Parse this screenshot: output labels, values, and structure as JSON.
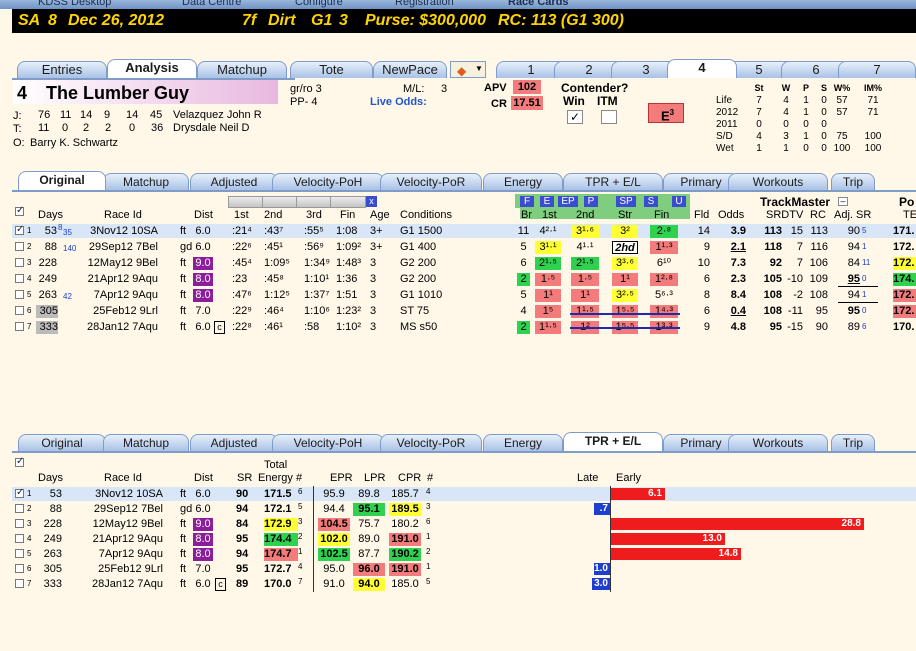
{
  "app_tabs": [
    "KDSS Desktop",
    "Data Centre",
    "Configure",
    "Registration",
    "Race Cards"
  ],
  "race": {
    "track": "SA",
    "race_no": "8",
    "date": "Dec 26, 2012",
    "distance": "7f",
    "surface": "Dirt",
    "grade": "G1",
    "gnum": "3",
    "purse": "Purse: $300,000",
    "rc": "RC: 113 (G1 300)"
  },
  "main_tabs": [
    "Entries",
    "Analysis",
    "Matchup",
    "Tote",
    "NewPace"
  ],
  "horse_tabs": [
    "1",
    "2",
    "3",
    "4",
    "5",
    "6",
    "7"
  ],
  "horse": {
    "num": "4",
    "name": "The Lumber Guy",
    "gr_ro": "gr/ro 3",
    "pp": "PP- 4",
    "ml_label": "M/L:",
    "ml": "3",
    "live_odds": "Live Odds:",
    "apv_label": "APV",
    "apv": "102",
    "cr_label": "CR",
    "cr": "17.51",
    "contender": "Contender?",
    "win": "Win",
    "itm": "ITM",
    "e_badge": "E",
    "e_sup": "3",
    "jockey_label": "J:",
    "jockey_stats": [
      "76",
      "11",
      "14",
      "9",
      "14",
      "45"
    ],
    "jockey": "Velazquez John R",
    "trainer_label": "T:",
    "trainer_stats": [
      "11",
      "0",
      "2",
      "2",
      "0",
      "36"
    ],
    "trainer": "Drysdale Neil D",
    "owner_label": "O:",
    "owner": "Barry K. Schwartz"
  },
  "record": {
    "headers": [
      "St",
      "W",
      "P",
      "S",
      "W%",
      "IM%"
    ],
    "rows": [
      {
        "label": "Life",
        "v": [
          "7",
          "4",
          "1",
          "0",
          "57",
          "71"
        ]
      },
      {
        "label": "2012",
        "v": [
          "7",
          "4",
          "1",
          "0",
          "57",
          "71"
        ]
      },
      {
        "label": "2011",
        "v": [
          "0",
          "0",
          "0",
          "0",
          "",
          ""
        ]
      },
      {
        "label": "S/D",
        "v": [
          "4",
          "3",
          "1",
          "0",
          "75",
          "100"
        ]
      },
      {
        "label": "Wet",
        "v": [
          "1",
          "1",
          "0",
          "0",
          "100",
          "100"
        ]
      }
    ]
  },
  "sub_tabs": [
    "Original",
    "Matchup",
    "Adjusted",
    "Velocity-PoH",
    "Velocity-PoR",
    "Energy",
    "TPR + E/L",
    "Primary",
    "Workouts",
    "Trip"
  ],
  "top_table": {
    "pace_buttons": [
      "F",
      "E",
      "EP",
      "P",
      "SP",
      "S",
      "U"
    ],
    "trackmaster": "TrackMaster",
    "headers": {
      "days": "Days",
      "race_id": "Race Id",
      "dist": "Dist",
      "c1": "1st",
      "c2": "2nd",
      "c3": "3rd",
      "fin": "Fin",
      "age": "Age",
      "cond": "Conditions",
      "br": "Br",
      "p1": "1st",
      "p2": "2nd",
      "str": "Str",
      "pfin": "Fin",
      "fld": "Fld",
      "odds": "Odds",
      "srdtv": "SRDTV",
      "rc": "RC",
      "adj": "Adj. SR",
      "po": "Po",
      "te": "TE"
    },
    "rows": [
      {
        "n": "1",
        "days": "53",
        "sup": "8",
        "sup2": "35",
        "rid": "3Nov12 10SA",
        "cond_s": "",
        "surf": "ft",
        "dist": "6.0",
        "c1": ":21⁴",
        "c2": ":43⁷",
        "c3": ":55⁵",
        "fin": "1:08",
        "age": "3+",
        "cond": "G1 1500",
        "br": "11",
        "p1": "4²·¹",
        "p2": "3¹·⁶",
        "str": "3²",
        "pfin": "2·⁸",
        "fld": "14",
        "odds": "3.9",
        "sr": "113",
        "dtv": "15",
        "rc": "113",
        "adj": "90",
        "adjs": "5",
        "te": "171."
      },
      {
        "n": "2",
        "days": "88",
        "sup": "",
        "sup2": "140",
        "rid": "29Sep12 7Bel",
        "surf": "gd",
        "dist": "6.0",
        "c1": ":22⁶",
        "c2": ":45¹",
        "c3": ":56⁹",
        "fin": "1:09²",
        "age": "3+",
        "cond": "G1 400",
        "br": "5",
        "p1": "3¹·¹",
        "p2": "4¹·¹",
        "str": "2hd",
        "pfin": "1¹·³",
        "fld": "9",
        "odds": "2.1",
        "sr": "118",
        "dtv": "7",
        "rc": "116",
        "adj": "94",
        "adjs": "1",
        "te": "172."
      },
      {
        "n": "3",
        "days": "228",
        "sup": "",
        "sup2": "",
        "rid": "12May12 9Bel",
        "surf": "ft",
        "dist": "9.0",
        "c1": ":45⁴",
        "c2": "1:09⁵",
        "c3": "1:34⁹",
        "fin": "1:48³",
        "age": "3",
        "cond": "G2 200",
        "br": "6",
        "p1": "2¹·⁵",
        "p2": "2¹·⁵",
        "str": "3³·⁶",
        "pfin": "6¹⁰",
        "fld": "10",
        "odds": "7.3",
        "sr": "92",
        "dtv": "7",
        "rc": "106",
        "adj": "84",
        "adjs": "11",
        "te": "172."
      },
      {
        "n": "4",
        "days": "249",
        "sup": "",
        "sup2": "",
        "rid": "21Apr12 9Aqu",
        "surf": "ft",
        "dist": "8.0",
        "c1": ":23",
        "c2": ":45⁸",
        "c3": "1:10¹",
        "fin": "1:36",
        "age": "3",
        "cond": "G2 200",
        "br": "2",
        "p1": "1·⁵",
        "p2": "1·⁵",
        "str": "1¹",
        "pfin": "1²·⁸",
        "fld": "6",
        "odds": "2.3",
        "sr": "105",
        "dtv": "-10",
        "rc": "109",
        "adj": "95",
        "adjs": "0",
        "te": "174."
      },
      {
        "n": "5",
        "days": "263",
        "sup": "",
        "sup2": "42",
        "rid": "7Apr12 9Aqu",
        "surf": "ft",
        "dist": "8.0",
        "c1": ":47⁶",
        "c2": "1:12⁵",
        "c3": "1:37⁷",
        "fin": "1:51",
        "age": "3",
        "cond": "G1 1010",
        "br": "5",
        "p1": "1¹",
        "p2": "1¹",
        "str": "3²·⁵",
        "pfin": "5⁶·³",
        "fld": "8",
        "odds": "8.4",
        "sr": "108",
        "dtv": "-2",
        "rc": "108",
        "adj": "94",
        "adjs": "1",
        "te": "172."
      },
      {
        "n": "6",
        "days": "305",
        "sup": "",
        "sup2": "",
        "rid": "25Feb12 9Lrl",
        "surf": "ft",
        "dist": "7.0",
        "c1": ":22⁹",
        "c2": ":46⁴",
        "c3": "1:10⁶",
        "fin": "1:23²",
        "age": "3",
        "cond": "ST 75",
        "br": "4",
        "p1": "1⁵",
        "p2": "1¹·⁵",
        "str": "1⁵·⁵",
        "pfin": "1⁴·³",
        "fld": "6",
        "odds": "0.4",
        "sr": "108",
        "dtv": "-11",
        "rc": "95",
        "adj": "95",
        "adjs": "0",
        "te": "172."
      },
      {
        "n": "7",
        "days": "333",
        "sup": "",
        "sup2": "",
        "rid": "28Jan12 7Aqu",
        "surf": "ft",
        "dist": "6.0",
        "c1": ":22⁸",
        "c2": ":46¹",
        "c3": ":58",
        "fin": "1:10²",
        "age": "3",
        "cond": "MS s50",
        "br": "2",
        "p1": "1¹·⁵",
        "p2": "1²",
        "str": "1⁵·⁵",
        "pfin": "1³·³",
        "fld": "9",
        "odds": "4.8",
        "sr": "95",
        "dtv": "-15",
        "rc": "90",
        "adj": "89",
        "adjs": "6",
        "te": "170."
      }
    ]
  },
  "bottom_table": {
    "headers": {
      "days": "Days",
      "race_id": "Race Id",
      "dist": "Dist",
      "sr": "SR",
      "total": "Total",
      "energy": "Energy",
      "hash": "#",
      "epr": "EPR",
      "lpr": "LPR",
      "cpr": "CPR",
      "hash2": "#",
      "late": "Late",
      "early": "Early"
    },
    "rows": [
      {
        "n": "1",
        "days": "53",
        "rid": "3Nov12 10SA",
        "surf": "ft",
        "dist": "6.0",
        "sr": "90",
        "en": "171.5",
        "ens": "6",
        "epr": "95.9",
        "lpr": "89.8",
        "cpr": "185.7",
        "cprs": "4",
        "late": "",
        "early": "6.1"
      },
      {
        "n": "2",
        "days": "88",
        "rid": "29Sep12 7Bel",
        "surf": "gd",
        "dist": "6.0",
        "sr": "94",
        "en": "172.1",
        "ens": "5",
        "epr": "94.4",
        "lpr": "95.1",
        "cpr": "189.5",
        "cprs": "3",
        "late": ".7",
        "early": ""
      },
      {
        "n": "3",
        "days": "228",
        "rid": "12May12 9Bel",
        "surf": "ft",
        "dist": "9.0",
        "sr": "84",
        "en": "172.9",
        "ens": "3",
        "epr": "104.5",
        "lpr": "75.7",
        "cpr": "180.2",
        "cprs": "6",
        "late": "",
        "early": "28.8"
      },
      {
        "n": "4",
        "days": "249",
        "rid": "21Apr12 9Aqu",
        "surf": "ft",
        "dist": "8.0",
        "sr": "95",
        "en": "174.4",
        "ens": "2",
        "epr": "102.0",
        "lpr": "89.0",
        "cpr": "191.0",
        "cprs": "1",
        "late": "",
        "early": "13.0"
      },
      {
        "n": "5",
        "days": "263",
        "rid": "7Apr12 9Aqu",
        "surf": "ft",
        "dist": "8.0",
        "sr": "94",
        "en": "174.7",
        "ens": "1",
        "epr": "102.5",
        "lpr": "87.7",
        "cpr": "190.2",
        "cprs": "2",
        "late": "",
        "early": "14.8"
      },
      {
        "n": "6",
        "days": "305",
        "rid": "25Feb12 9Lrl",
        "surf": "ft",
        "dist": "7.0",
        "sr": "95",
        "en": "172.7",
        "ens": "4",
        "epr": "95.0",
        "lpr": "96.0",
        "cpr": "191.0",
        "cprs": "1",
        "late": "1.0",
        "early": ""
      },
      {
        "n": "7",
        "days": "333",
        "rid": "28Jan12 7Aqu",
        "surf": "ft",
        "dist": "6.0",
        "sr": "89",
        "en": "170.0",
        "ens": "7",
        "epr": "91.0",
        "lpr": "94.0",
        "cpr": "185.0",
        "cprs": "5",
        "late": "3.0",
        "early": ""
      }
    ]
  }
}
